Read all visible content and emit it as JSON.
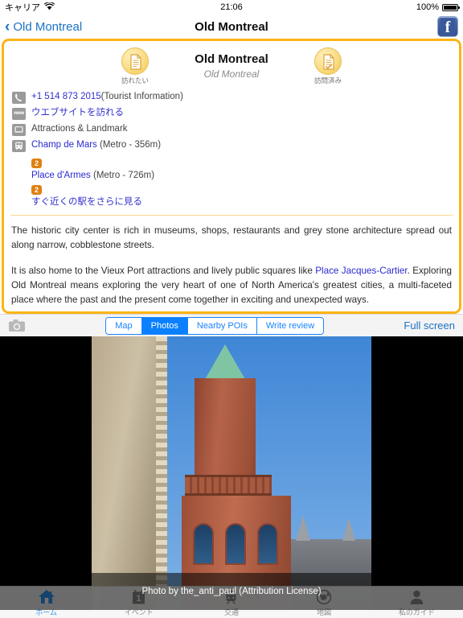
{
  "statusbar": {
    "carrier": "キャリア",
    "wifi_icon": "wifi-icon",
    "time": "21:06",
    "battery_percent": "100%",
    "battery_icon": "battery-full-icon"
  },
  "navbar": {
    "back_label": "Old Montreal",
    "back_chevron": "chevron-left-icon",
    "title": "Old Montreal",
    "facebook_icon": "facebook-icon",
    "facebook_glyph": "f"
  },
  "poi": {
    "title": "Old Montreal",
    "subtitle": "Old Montreal",
    "want_to_visit": {
      "label": "訪れたい",
      "icon": "note-add-icon"
    },
    "visited": {
      "label": "訪問済み",
      "icon": "note-check-icon"
    },
    "info_rows": [
      {
        "icon": "phone-icon",
        "link": "+1 514 873 2015",
        "suffix": "(Tourist Information)"
      },
      {
        "icon": "www-icon",
        "icon_text": "www",
        "link": "ウエブサイトを訪れる",
        "suffix": ""
      },
      {
        "icon": "monitor-icon",
        "link": "",
        "suffix": "Attractions & Landmark"
      }
    ],
    "transit": {
      "icon": "train-icon",
      "stations": [
        {
          "name": "Champ de Mars",
          "detail": "(Metro - 356m)",
          "badge": "2"
        },
        {
          "name": "Place d'Armes",
          "detail": "(Metro - 726m)",
          "badge": "2"
        }
      ],
      "more_link": "すぐ近くの駅をさらに見る"
    },
    "description": [
      "The historic city center is rich in museums, shops, restaurants and grey stone architecture spread out along narrow, cobblestone streets.",
      "It is also home to the Vieux Port attractions and lively public squares like Place Jacques-Cartier. Exploring Old Montreal means exploring the very heart of one of North America's greatest cities, a multi-faceted place where the past and the present come together in exciting and unexpected ways."
    ],
    "description_link": "Place Jacques-Cartier"
  },
  "toolbar": {
    "camera_icon": "camera-icon",
    "segments": [
      {
        "label": "Map",
        "selected": false
      },
      {
        "label": "Photos",
        "selected": true
      },
      {
        "label": "Nearby POIs",
        "selected": false
      },
      {
        "label": "Write review",
        "selected": false
      }
    ],
    "fullscreen_label": "Full screen"
  },
  "photo": {
    "caption": "Photo by the_anti_paul (Attribution License)"
  },
  "tabbar": {
    "items": [
      {
        "label": "ホーム",
        "icon": "home-icon",
        "selected": true
      },
      {
        "label": "イベント",
        "icon": "calendar-icon",
        "selected": false
      },
      {
        "label": "交通",
        "icon": "train-icon",
        "selected": false
      },
      {
        "label": "地図",
        "icon": "globe-icon",
        "selected": false
      },
      {
        "label": "私のガイド",
        "icon": "person-icon",
        "selected": false
      }
    ]
  },
  "colors": {
    "accent_orange": "#fcb415",
    "link_blue": "#1a72c4",
    "segment_blue": "#0a80ff",
    "badge_orange": "#e08010",
    "tab_active": "#2f95ef"
  }
}
